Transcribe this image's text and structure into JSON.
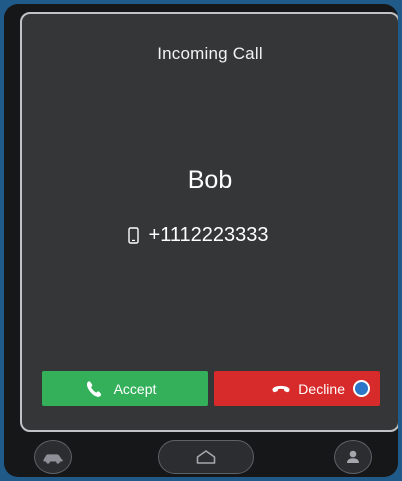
{
  "dialog": {
    "title": "Incoming Call",
    "caller_name": "Bob",
    "caller_number": "+1112223333",
    "number_icon": "mobile-phone-icon"
  },
  "actions": {
    "accept_label": "Accept",
    "accept_icon": "phone-icon",
    "accept_color": "#34b05b",
    "decline_label": "Decline",
    "decline_icon": "phone-hangup-icon",
    "decline_color": "#d72a2a",
    "decline_indicator": "selection-indicator"
  },
  "navbar": {
    "left_icon": "car-icon",
    "center_icon": "home-icon",
    "right_icon": "user-icon"
  }
}
